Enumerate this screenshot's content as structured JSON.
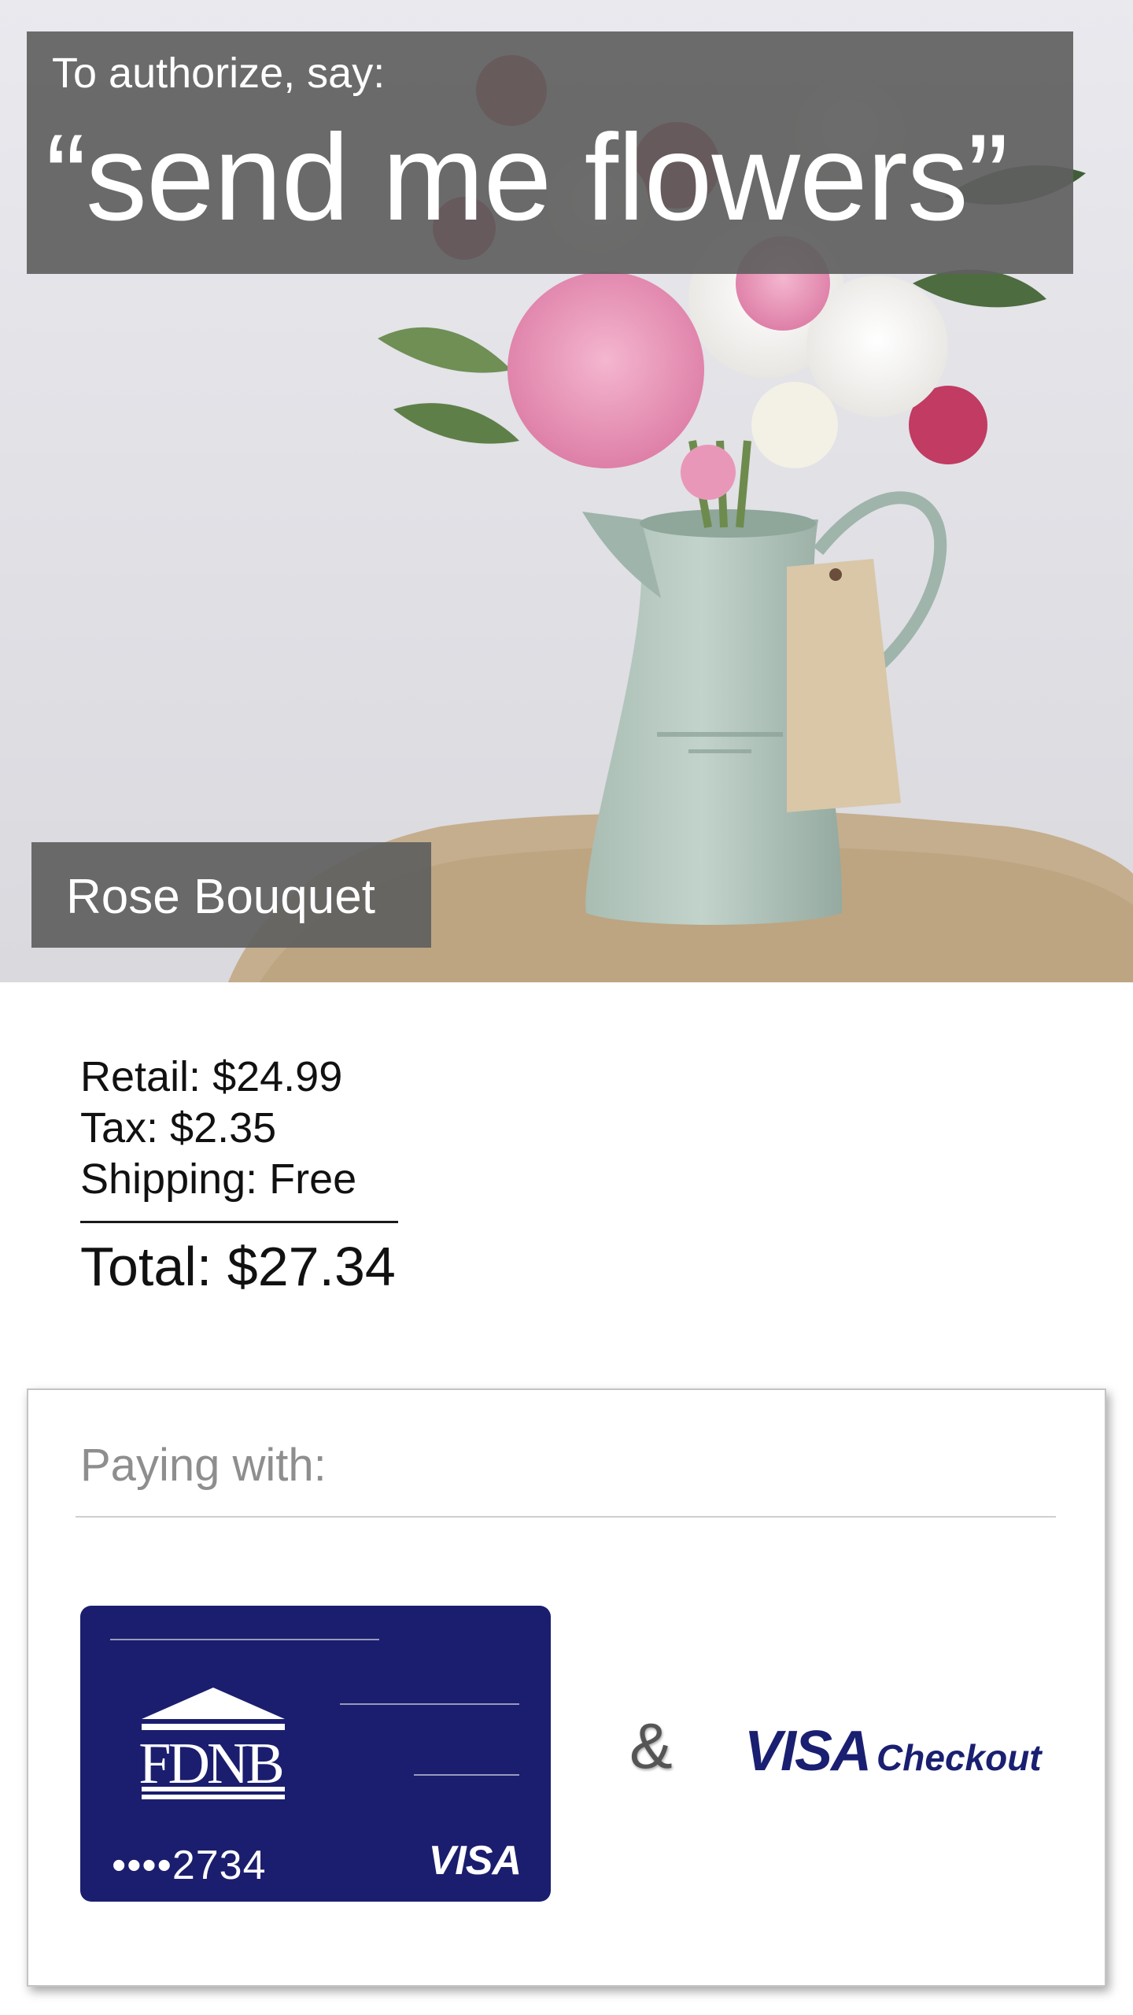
{
  "auth": {
    "prompt": "To authorize, say:",
    "phrase": "“send me flowers”"
  },
  "product": {
    "name": "Rose Bouquet",
    "image": "flower-bouquet-photo"
  },
  "summary": {
    "retail": "Retail: $24.99",
    "tax": "Tax: $2.35",
    "shipping": "Shipping: Free",
    "total": "Total: $27.34"
  },
  "payment": {
    "heading": "Paying with:",
    "card": {
      "bank_name": "FDNB",
      "number_masked": "••••2734",
      "network": "VISA",
      "color": "#1b1e6e"
    },
    "conjunction": "&",
    "wallet": {
      "brand": "VISA",
      "product": "Checkout",
      "color": "#1a1f71"
    }
  },
  "colors": {
    "accent_gold": "#f0cf84",
    "overlay_gray": "#5f5f5f"
  }
}
